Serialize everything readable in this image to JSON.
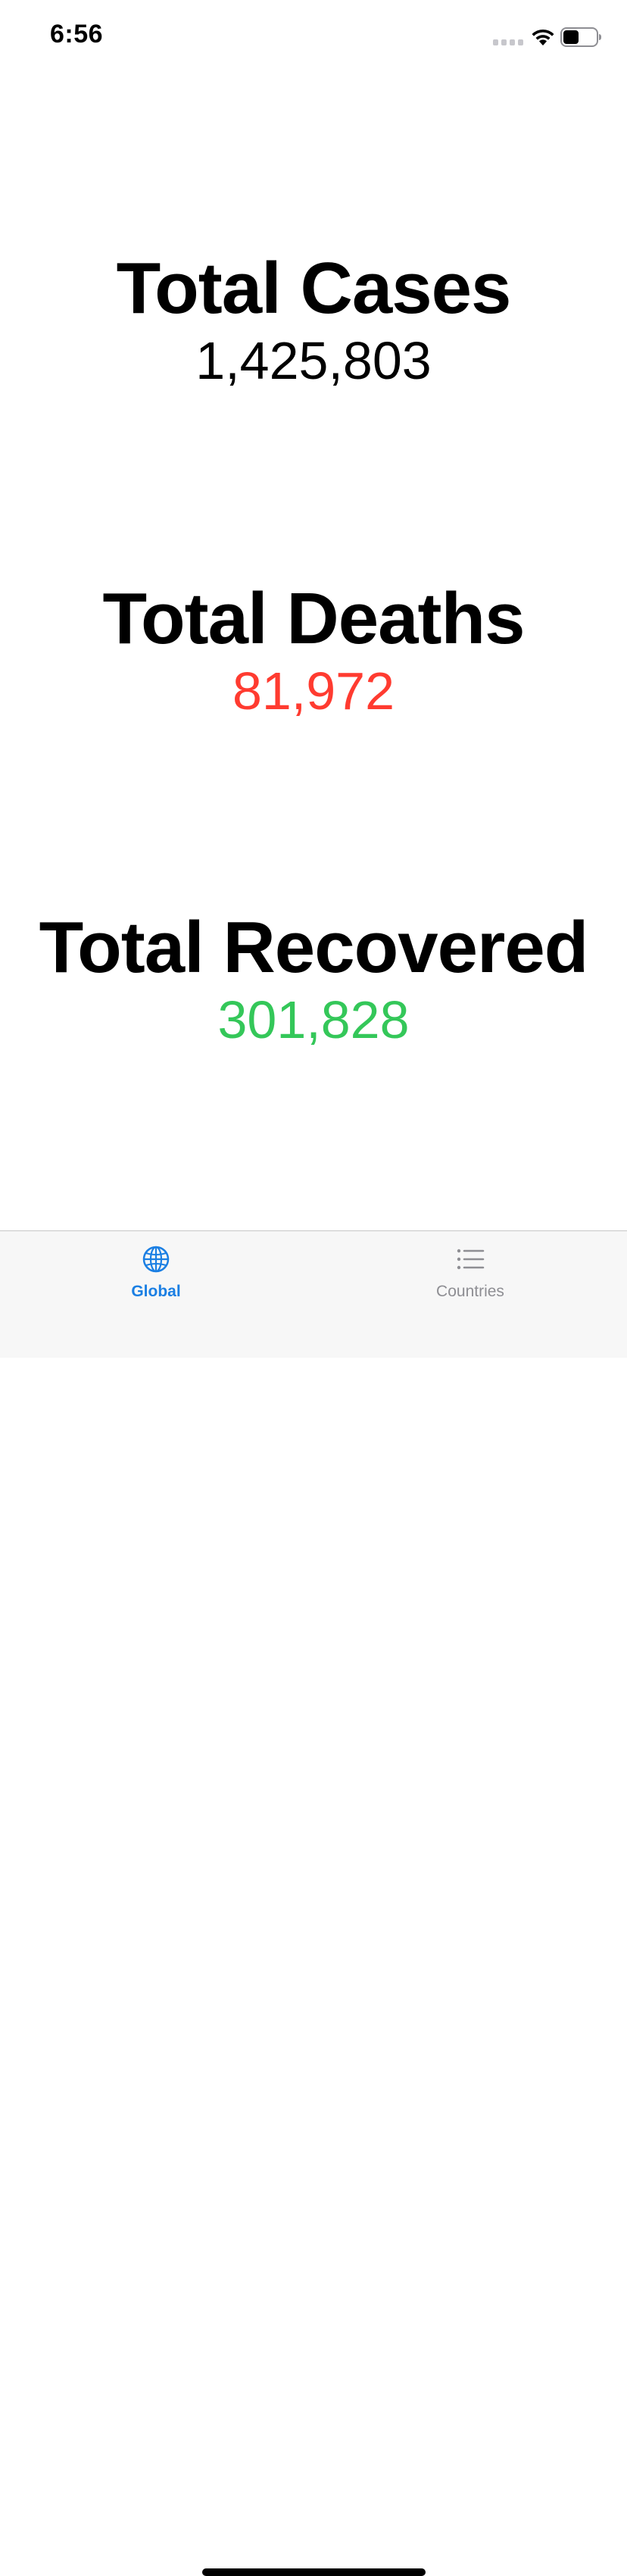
{
  "status_bar": {
    "time": "6:56",
    "icons": [
      "signal-icon",
      "wifi-icon",
      "battery-icon"
    ]
  },
  "stats": {
    "cases": {
      "title": "Total Cases",
      "value": "1,425,803",
      "color": "#000000"
    },
    "deaths": {
      "title": "Total Deaths",
      "value": "81,972",
      "color": "#ff3b30"
    },
    "recovered": {
      "title": "Total Recovered",
      "value": "301,828",
      "color": "#34c759"
    }
  },
  "tab_bar": {
    "selected": "Global",
    "tabs": [
      {
        "label": "Global",
        "icon": "globe-icon",
        "color": "#1b7fe3"
      },
      {
        "label": "Countries",
        "icon": "list-icon",
        "color": "#8e8e93"
      }
    ]
  }
}
